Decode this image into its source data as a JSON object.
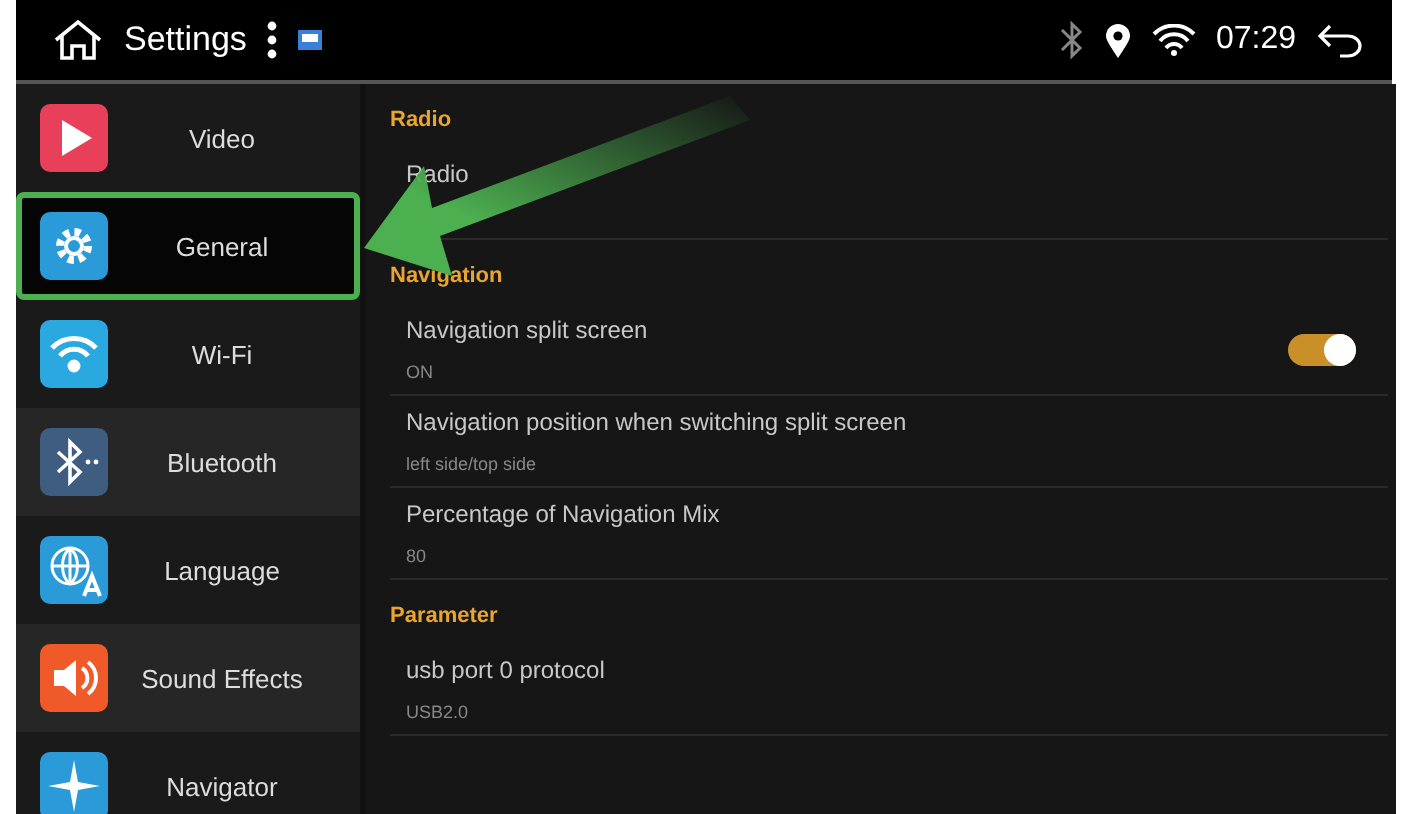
{
  "status_bar": {
    "title": "Settings",
    "time": "07:29"
  },
  "sidebar": {
    "items": [
      {
        "label": "Video",
        "selected": false
      },
      {
        "label": "General",
        "selected": true
      },
      {
        "label": "Wi-Fi",
        "selected": false
      },
      {
        "label": "Bluetooth",
        "selected": false
      },
      {
        "label": "Language",
        "selected": false
      },
      {
        "label": "Sound Effects",
        "selected": false
      },
      {
        "label": "Navigator",
        "selected": false
      }
    ]
  },
  "sections": [
    {
      "title": "Radio",
      "rows": [
        {
          "title": "Radio"
        }
      ]
    },
    {
      "title": "Navigation",
      "rows": [
        {
          "title": "Navigation split screen",
          "value": "ON",
          "toggle": {
            "on": true
          }
        },
        {
          "title": "Navigation position when switching split screen",
          "value": "left side/top side"
        },
        {
          "title": "Percentage of Navigation Mix",
          "value": "80"
        }
      ]
    },
    {
      "title": "Parameter",
      "rows": [
        {
          "title": "usb port 0 protocol",
          "value": "USB2.0"
        }
      ]
    }
  ]
}
